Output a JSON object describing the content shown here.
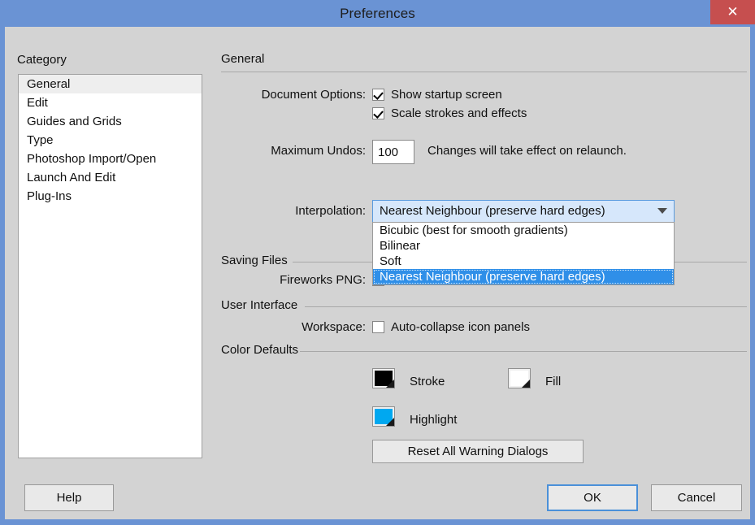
{
  "window": {
    "title": "Preferences",
    "close_label": "✕",
    "accent_titlebar": "#6a93d4",
    "close_bg": "#c64f4f",
    "body_bg": "#d3d3d3"
  },
  "category": {
    "label": "Category",
    "items": [
      {
        "label": "General",
        "selected": true
      },
      {
        "label": "Edit",
        "selected": false
      },
      {
        "label": "Guides and Grids",
        "selected": false
      },
      {
        "label": "Type",
        "selected": false
      },
      {
        "label": "Photoshop Import/Open",
        "selected": false
      },
      {
        "label": "Launch And Edit",
        "selected": false
      },
      {
        "label": "Plug-Ins",
        "selected": false
      }
    ]
  },
  "pane": {
    "title": "General",
    "document_options": {
      "label": "Document Options:",
      "show_startup_screen": "Show startup screen",
      "scale_strokes": "Scale strokes and effects"
    },
    "maximum_undos": {
      "label": "Maximum Undos:",
      "value": "100",
      "hint": "Changes will take effect on relaunch."
    },
    "interpolation": {
      "label": "Interpolation:",
      "value": "Nearest Neighbour (preserve hard edges)",
      "arrow": "chevron-down-icon",
      "options": [
        {
          "label": "Bicubic (best for smooth gradients)",
          "selected": false
        },
        {
          "label": "Bilinear",
          "selected": false
        },
        {
          "label": "Soft",
          "selected": false
        },
        {
          "label": "Nearest Neighbour (preserve hard edges)",
          "selected": true
        }
      ]
    },
    "saving_files": {
      "heading": "Saving Files",
      "fireworks_label": "Fireworks PNG:"
    },
    "user_interface": {
      "heading": "User Interface",
      "workspace_label": "Workspace:",
      "auto_collapse": "Auto-collapse icon panels"
    },
    "color_defaults": {
      "heading": "Color Defaults",
      "stroke_label": "Stroke",
      "stroke_color": "#000000",
      "fill_label": "Fill",
      "fill_color": "#ffffff",
      "highlight_label": "Highlight",
      "highlight_color": "#00a8f0",
      "reset_button": "Reset All Warning Dialogs"
    }
  },
  "footer": {
    "help": "Help",
    "ok": "OK",
    "cancel": "Cancel"
  }
}
